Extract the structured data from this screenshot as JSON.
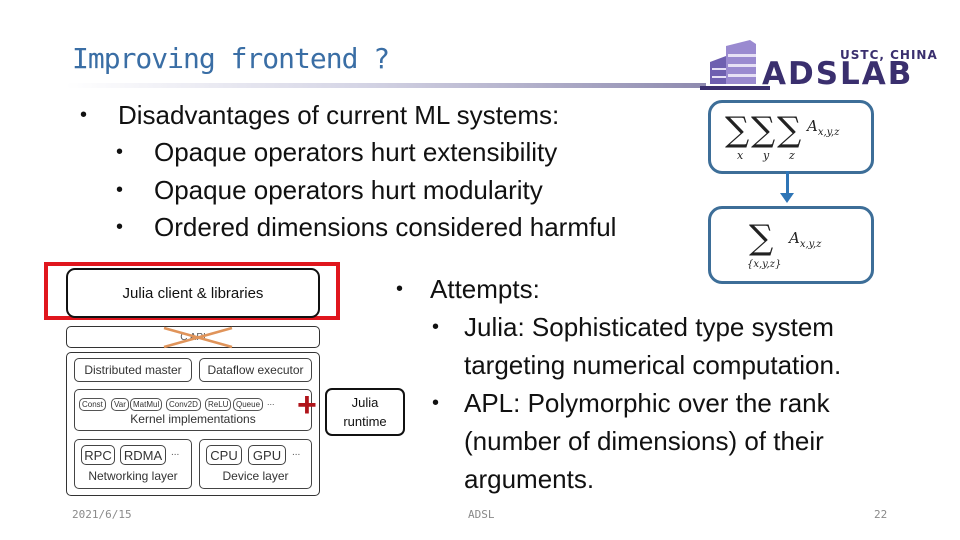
{
  "slide": {
    "title": "Improving frontend ?",
    "logo": {
      "top_text": "USTC, CHINA",
      "main_text": "ADSLAB"
    },
    "disadvantages": {
      "heading": "Disadvantages of current ML systems:",
      "items": [
        "Opaque operators hurt extensibility",
        "Opaque operators hurt modularity",
        "Ordered dimensions considered harmful"
      ]
    },
    "formula": {
      "top": {
        "sum_symbol": "∑",
        "indices": [
          "x",
          "y",
          "z"
        ],
        "term": "A",
        "term_sub": "x,y,z"
      },
      "bottom": {
        "sum_symbol": "∑",
        "index_set": "{x,y,z}",
        "term": "A",
        "term_sub": "x,y,z"
      }
    },
    "diagram": {
      "julia_client": "Julia client & libraries",
      "c_api": "C API",
      "distributed_master": "Distributed master",
      "dataflow_executor": "Dataflow executor",
      "kernels": [
        "Const",
        "Var",
        "MatMul",
        "Conv2D",
        "ReLU",
        "Queue",
        "..."
      ],
      "kernel_label": "Kernel implementations",
      "networking": {
        "items": [
          "RPC",
          "RDMA",
          "..."
        ],
        "label": "Networking layer"
      },
      "device": {
        "items": [
          "CPU",
          "GPU",
          "..."
        ],
        "label": "Device layer"
      },
      "plus_symbol": "+",
      "julia_runtime": [
        "Julia",
        "runtime"
      ],
      "colors": {
        "highlight": "#e0161d",
        "cross": "#e0945a",
        "plus": "#b0141a"
      }
    },
    "attempts": {
      "heading": "Attempts:",
      "items": [
        [
          "Julia: Sophisticated type system",
          "targeting numerical computation."
        ],
        [
          "APL: Polymorphic over the rank",
          "(number of dimensions) of their",
          "arguments."
        ]
      ]
    },
    "footer": {
      "date": "2021/6/15",
      "center": "ADSL",
      "page_number": "22"
    },
    "colors": {
      "title": "#3a6ea5",
      "formula_border": "#3d6e98",
      "arrow": "#2e75b6",
      "logo": "#3a2f6e"
    }
  }
}
